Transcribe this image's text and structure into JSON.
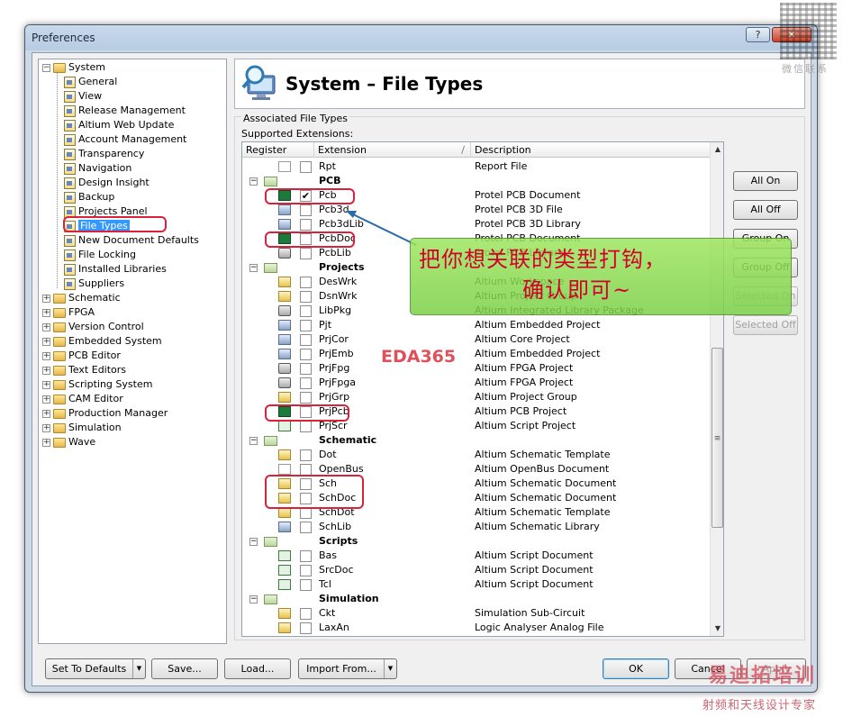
{
  "window": {
    "title": "Preferences",
    "help_glyph": "?",
    "close_glyph": "✕"
  },
  "tree": {
    "items": [
      {
        "label": "System",
        "level": 0,
        "kind": "open"
      },
      {
        "label": "General",
        "level": 1
      },
      {
        "label": "View",
        "level": 1
      },
      {
        "label": "Release Management",
        "level": 1
      },
      {
        "label": "Altium Web Update",
        "level": 1
      },
      {
        "label": "Account Management",
        "level": 1
      },
      {
        "label": "Transparency",
        "level": 1
      },
      {
        "label": "Navigation",
        "level": 1
      },
      {
        "label": "Design Insight",
        "level": 1
      },
      {
        "label": "Backup",
        "level": 1
      },
      {
        "label": "Projects Panel",
        "level": 1
      },
      {
        "label": "File Types",
        "level": 1,
        "selected": true
      },
      {
        "label": "New Document Defaults",
        "level": 1
      },
      {
        "label": "File Locking",
        "level": 1
      },
      {
        "label": "Installed Libraries",
        "level": 1
      },
      {
        "label": "Suppliers",
        "level": 1
      },
      {
        "label": "Schematic",
        "level": 0
      },
      {
        "label": "FPGA",
        "level": 0
      },
      {
        "label": "Version Control",
        "level": 0
      },
      {
        "label": "Embedded System",
        "level": 0
      },
      {
        "label": "PCB Editor",
        "level": 0
      },
      {
        "label": "Text Editors",
        "level": 0
      },
      {
        "label": "Scripting System",
        "level": 0
      },
      {
        "label": "CAM Editor",
        "level": 0
      },
      {
        "label": "Production Manager",
        "level": 0
      },
      {
        "label": "Simulation",
        "level": 0
      },
      {
        "label": "Wave",
        "level": 0
      }
    ]
  },
  "header": {
    "title": "System – File Types"
  },
  "group": {
    "label": "Associated File Types",
    "sublabel": "Supported Extensions:"
  },
  "grid": {
    "columns": {
      "register": "Register",
      "extension": "Extension",
      "description": "Description",
      "sort_glyph": "/"
    },
    "rows": [
      {
        "type": "file",
        "icon": "doc",
        "ext": "Rpt",
        "desc": "Report File",
        "checked": false
      },
      {
        "type": "cat",
        "ext": "PCB"
      },
      {
        "type": "file",
        "icon": "green",
        "ext": "Pcb",
        "desc": "Protel PCB Document",
        "checked": true
      },
      {
        "type": "file",
        "icon": "blu",
        "ext": "Pcb3d",
        "desc": "Protel PCB 3D File",
        "checked": false
      },
      {
        "type": "file",
        "icon": "blu",
        "ext": "Pcb3dLib",
        "desc": "Protel PCB 3D Library",
        "checked": false
      },
      {
        "type": "file",
        "icon": "green",
        "ext": "PcbDoc",
        "desc": "Protel PCB Document",
        "checked": false
      },
      {
        "type": "file",
        "icon": "lib",
        "ext": "PcbLib",
        "desc": "Protel PCB Library",
        "checked": false
      },
      {
        "type": "cat",
        "ext": "Projects"
      },
      {
        "type": "file",
        "icon": "yel",
        "ext": "DesWrk",
        "desc": "Altium Workspace",
        "checked": false
      },
      {
        "type": "file",
        "icon": "yel",
        "ext": "DsnWrk",
        "desc": "Altium Project Group",
        "checked": false
      },
      {
        "type": "file",
        "icon": "lib",
        "ext": "LibPkg",
        "desc": "Altium Integrated Library Package",
        "checked": false
      },
      {
        "type": "file",
        "icon": "blu",
        "ext": "Pjt",
        "desc": "Altium Embedded Project",
        "checked": false
      },
      {
        "type": "file",
        "icon": "blu",
        "ext": "PrjCor",
        "desc": "Altium Core Project",
        "checked": false
      },
      {
        "type": "file",
        "icon": "blu",
        "ext": "PrjEmb",
        "desc": "Altium Embedded Project",
        "checked": false
      },
      {
        "type": "file",
        "icon": "lib",
        "ext": "PrjFpg",
        "desc": "Altium FPGA Project",
        "checked": false
      },
      {
        "type": "file",
        "icon": "lib",
        "ext": "PrjFpga",
        "desc": "Altium FPGA Project",
        "checked": false
      },
      {
        "type": "file",
        "icon": "yel",
        "ext": "PrjGrp",
        "desc": "Altium Project Group",
        "checked": false
      },
      {
        "type": "file",
        "icon": "green",
        "ext": "PrjPcb",
        "desc": "Altium PCB Project",
        "checked": false
      },
      {
        "type": "file",
        "icon": "scr",
        "ext": "PrjScr",
        "desc": "Altium Script Project",
        "checked": false
      },
      {
        "type": "cat",
        "ext": "Schematic"
      },
      {
        "type": "file",
        "icon": "yel",
        "ext": "Dot",
        "desc": "Altium Schematic Template",
        "checked": false
      },
      {
        "type": "file",
        "icon": "doc",
        "ext": "OpenBus",
        "desc": "Altium OpenBus Document",
        "checked": false
      },
      {
        "type": "file",
        "icon": "yel",
        "ext": "Sch",
        "desc": "Altium Schematic Document",
        "checked": false
      },
      {
        "type": "file",
        "icon": "yel",
        "ext": "SchDoc",
        "desc": "Altium Schematic Document",
        "checked": false
      },
      {
        "type": "file",
        "icon": "yel",
        "ext": "SchDot",
        "desc": "Altium Schematic Template",
        "checked": false
      },
      {
        "type": "file",
        "icon": "blu",
        "ext": "SchLib",
        "desc": "Altium Schematic Library",
        "checked": false
      },
      {
        "type": "cat",
        "ext": "Scripts"
      },
      {
        "type": "file",
        "icon": "scr",
        "ext": "Bas",
        "desc": "Altium Script Document",
        "checked": false
      },
      {
        "type": "file",
        "icon": "scr",
        "ext": "SrcDoc",
        "desc": "Altium Script Document",
        "checked": false
      },
      {
        "type": "file",
        "icon": "scr",
        "ext": "Tcl",
        "desc": "Altium Script Document",
        "checked": false
      },
      {
        "type": "cat",
        "ext": "Simulation"
      },
      {
        "type": "file",
        "icon": "yel",
        "ext": "Ckt",
        "desc": "Simulation Sub-Circuit",
        "checked": false
      },
      {
        "type": "file",
        "icon": "yel",
        "ext": "LaxAn",
        "desc": "Logic Analyser Analog File",
        "checked": false
      }
    ]
  },
  "side_buttons": [
    {
      "label": "All On",
      "enabled": true
    },
    {
      "label": "All Off",
      "enabled": true
    },
    {
      "label": "Group On",
      "enabled": true
    },
    {
      "label": "Group Off",
      "enabled": true
    },
    {
      "label": "Selected On",
      "enabled": false
    },
    {
      "label": "Selected Off",
      "enabled": false
    }
  ],
  "bottom": {
    "set_to_defaults": "Set To Defaults",
    "save": "Save...",
    "load": "Load...",
    "import_from": "Import From...",
    "ok": "OK",
    "cancel": "Cancel",
    "apply": "Apply"
  },
  "annotation": {
    "line1": "把你想关联的类型打钩，",
    "line2": "确认即可~",
    "watermark": "EDA365",
    "qr_caption": "微信联系",
    "logo_cn": "易迪拓培训",
    "logo_sub": "射频和天线设计专家"
  },
  "colors": {
    "selection": "#3399ff",
    "annotation_red": "#d8223c",
    "callout_green": "#8fdb52"
  }
}
